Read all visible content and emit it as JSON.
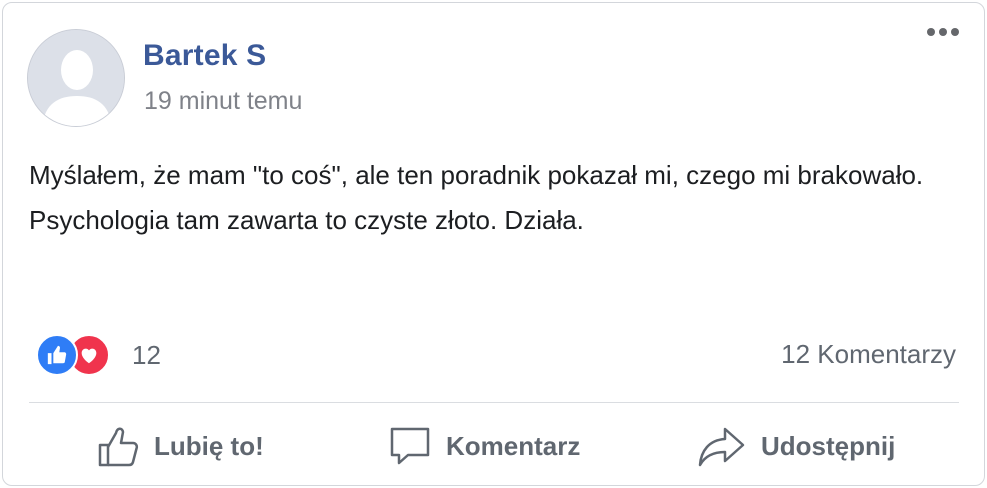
{
  "post": {
    "author": "Bartek S",
    "timestamp": "19 minut temu",
    "text": "Myślałem, że mam \"to coś\", ale ten poradnik pokazał mi, czego mi brakowało. Psychologia tam zawarta to czyste złoto. Działa.",
    "more_icon": "ellipsis-icon"
  },
  "reactions": {
    "icons": [
      "like-reaction-icon",
      "love-reaction-icon"
    ],
    "count": "12",
    "comments": "12 Komentarzy"
  },
  "actions": {
    "like_label": "Lubię to!",
    "comment_label": "Komentarz",
    "share_label": "Udostępnij"
  },
  "colors": {
    "author": "#3b5998",
    "like_blue": "#2f7df6",
    "love_red": "#f0344d",
    "muted_text": "#606770"
  }
}
